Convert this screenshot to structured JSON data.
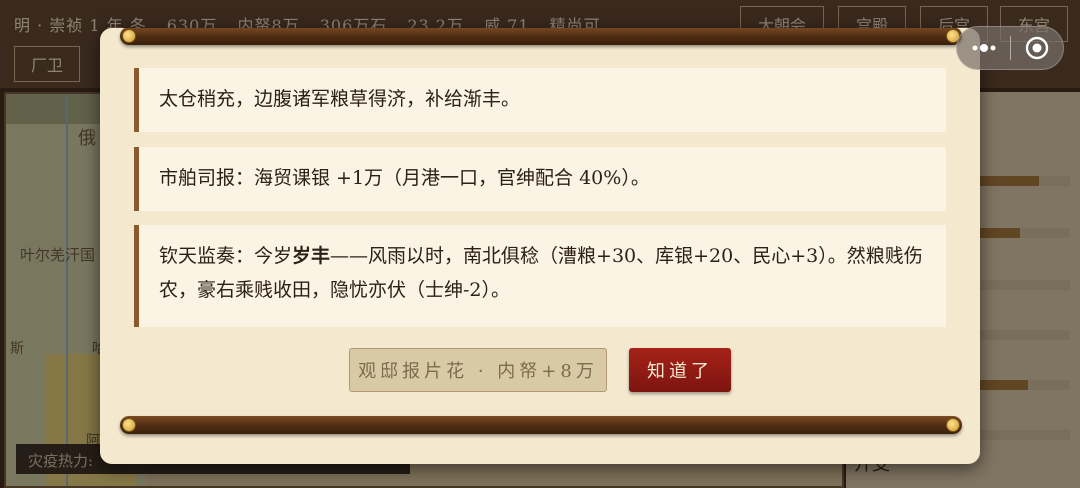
{
  "topbar": {
    "dynasty": "明 · 崇祯 1 年 冬",
    "stats": [
      "630万",
      "内帑8万",
      "306万石",
      "23.2万",
      "威 71",
      "精尚可"
    ],
    "buttons": [
      "大朝会",
      "宫殿",
      "后宫",
      "东宫",
      "厂卫"
    ]
  },
  "map": {
    "labels": [
      "俄",
      "叶尔羌汗国",
      "斯",
      "哈",
      "阿"
    ]
  },
  "right_panel": {
    "bar_levels": [
      0.85,
      0.76,
      0.0,
      0.0,
      0.8,
      0.0
    ],
    "footer_text": "开支"
  },
  "disaster_label": "灾疫热力",
  "capsule": {
    "more_icon": "more-dots-icon",
    "close_icon": "target-close-icon"
  },
  "modal": {
    "entries": [
      {
        "text": "太仓稍充，边腹诸军粮草得济，补给渐丰。"
      },
      {
        "text": "市舶司报：海贸课银 +1万（月港一口，官绅配合 40%）。"
      },
      {
        "prefix": "钦天监奏：今岁",
        "bold": "岁丰",
        "suffix": "——风雨以时，南北俱稔（漕粮+30、库银+20、民心+3）。然粮贱伤农，豪右乘贱收田，隐忧亦伏（士绅-2）。"
      }
    ],
    "secondary_button": "观邸报片花 · 内帑+8万",
    "primary_button": "知道了"
  },
  "colors": {
    "accent_red": "#8f1a12",
    "scroll_wood": "#5a3417",
    "paper": "#f4e8cf"
  }
}
